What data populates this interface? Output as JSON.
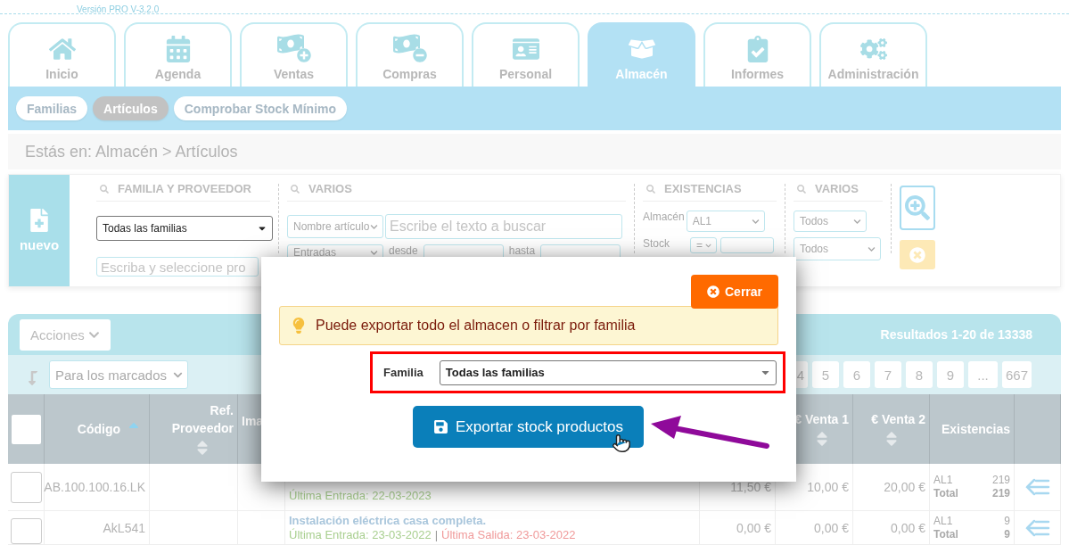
{
  "version": "Versión PRO V-3.2.0",
  "tabs": [
    {
      "label": "Inicio",
      "selected": false
    },
    {
      "label": "Agenda",
      "selected": false
    },
    {
      "label": "Ventas",
      "selected": false
    },
    {
      "label": "Compras",
      "selected": false
    },
    {
      "label": "Personal",
      "selected": false
    },
    {
      "label": "Almacén",
      "selected": true
    },
    {
      "label": "Informes",
      "selected": false
    },
    {
      "label": "Administración",
      "selected": false
    }
  ],
  "subtabs": [
    {
      "label": "Familias",
      "selected": false
    },
    {
      "label": "Artículos",
      "selected": true
    },
    {
      "label": "Comprobar Stock Mínimo",
      "selected": false
    }
  ],
  "breadcrumb": "Estás en: Almacén > Artículos",
  "new_button": "nuevo",
  "filters": {
    "familia_proveedor": {
      "title": "FAMILIA Y PROVEEDOR",
      "familia": "Todas las familias",
      "proveedor_placeholder": "Escriba y seleccione pro"
    },
    "varios": {
      "title": "VARIOS",
      "field_select": "Nombre artículo",
      "search_placeholder": "Escribe el texto a buscar",
      "date_select": "Entradas",
      "from_label": "desde",
      "to_label": "hasta"
    },
    "existencias": {
      "title": "EXISTENCIAS",
      "almacen_label": "Almacén",
      "almacen": "AL1",
      "stock_label": "Stock",
      "stock_operator": "="
    },
    "varios_2": {
      "title": "VARIOS",
      "select_1": "Todos",
      "select_2": "Todos"
    }
  },
  "results": {
    "actions": "Acciones",
    "summary": "Resultados 1-20 de 13338",
    "bulk_select": "Para los marcados",
    "pages": [
      "4",
      "5",
      "6",
      "7",
      "8",
      "9",
      "...",
      "667"
    ]
  },
  "table": {
    "all_checked": false,
    "columns": [
      {
        "label": "Código",
        "sorted_ascending": true
      },
      {
        "label": "Ref. Proveedor",
        "sorted_ascending": false
      },
      {
        "label": "Ima"
      },
      {
        "label": "€ Venta 1",
        "sorted_ascending": false
      },
      {
        "label": "€ Venta 2",
        "sorted_ascending": false
      },
      {
        "label": "Existencias"
      }
    ],
    "separator": "|",
    "rows": [
      {
        "checked": false,
        "code": "AB.100.100.16.LK",
        "history": [
          {
            "kind": "entry",
            "text": "Última Entrada: 22-03-2023"
          }
        ],
        "price_1": "11,50 €",
        "price_2": "10,00 €",
        "price_3": "20,00 €",
        "warehouse": "AL1",
        "qty": "219",
        "total_label": "Total",
        "total": "219"
      },
      {
        "checked": false,
        "code": "AkL541",
        "name": "Instalación eléctrica casa completa.",
        "history": [
          {
            "kind": "entry",
            "text": "Última Entrada: 23-03-2022"
          },
          {
            "kind": "exit",
            "text": "Última Salida: 23-03-2022"
          }
        ],
        "price_1": "0,00 €",
        "price_2": "0,00 €",
        "price_3": "0,00 €",
        "warehouse": "AL1",
        "qty": "9",
        "total_label": "Total",
        "total": "9"
      }
    ]
  },
  "modal": {
    "close": "Cerrar",
    "alert": "Puede exportar todo el almacen o filtrar por familia",
    "field_label": "Familia",
    "field_value": "Todas las familias",
    "highlighted": true,
    "export": "Exportar stock productos"
  }
}
